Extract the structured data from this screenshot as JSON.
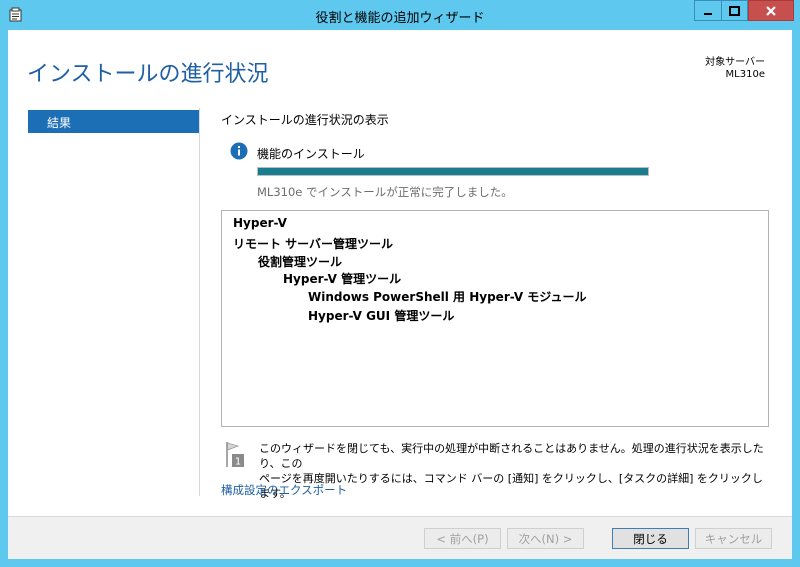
{
  "window": {
    "title": "役割と機能の追加ウィザード",
    "icon": "wizard-app-icon",
    "controls": {
      "minimize": "minimize-icon",
      "maximize": "maximize-icon",
      "close": "close-icon"
    }
  },
  "header": {
    "page_title": "インストールの進行状況",
    "target_label": "対象サーバー",
    "target_server": "ML310e"
  },
  "nav": {
    "items": [
      {
        "label": "結果",
        "selected": true
      }
    ]
  },
  "main": {
    "section_label": "インストールの進行状況の表示",
    "feature_install_label": "機能のインストール",
    "progress_fraction": 1.0,
    "status_message": "ML310e でインストールが正常に完了しました。",
    "results": [
      {
        "text": "Hyper-V",
        "level": 0
      },
      {
        "text": "リモート サーバー管理ツール",
        "level": 0
      },
      {
        "text": "役割管理ツール",
        "level": 1
      },
      {
        "text": "Hyper-V 管理ツール",
        "level": 2
      },
      {
        "text": "Windows PowerShell 用 Hyper-V モジュール",
        "level": 3
      },
      {
        "text": "Hyper-V GUI 管理ツール",
        "level": 3
      }
    ],
    "note_line1": "このウィザードを閉じても、実行中の処理が中断されることはありません。処理の進行状況を表示したり、この",
    "note_line2": "ページを再度開いたりするには、コマンド バーの [通知] をクリックし、[タスクの詳細] をクリックします。",
    "notification_badge": "1",
    "export_link": "構成設定のエクスポート"
  },
  "footer": {
    "prev_label": "< 前へ(P)",
    "next_label": "次へ(N) >",
    "close_label": "閉じる",
    "cancel_label": "キャンセル"
  },
  "colors": {
    "titlebar": "#5ec8ef",
    "accent": "#1f5fa3",
    "nav_selected": "#1d6fb5",
    "progress": "#177d8f",
    "close_button": "#c7504f"
  }
}
